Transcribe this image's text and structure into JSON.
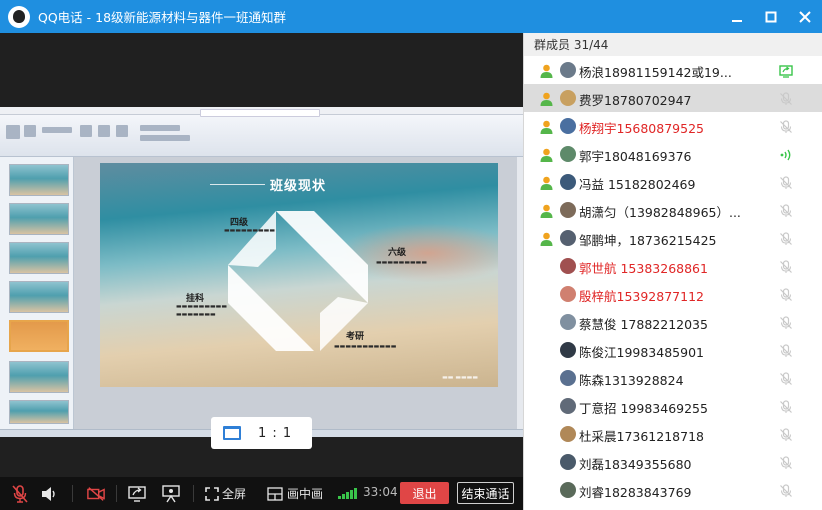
{
  "window": {
    "title": "QQ电话 - 18级新能源材料与器件一班通知群"
  },
  "slide": {
    "title": "班级现状",
    "labels": {
      "four": "四级",
      "six": "六级",
      "failed": "挂科",
      "kaoyan": "考研"
    }
  },
  "ratio": {
    "label": "1 : 1"
  },
  "toolbar": {
    "fullscreen": "全屏",
    "pip": "画中画",
    "duration": "33:04",
    "exit": "退出",
    "end_call": "结束通话",
    "signal_color": "#39c54a"
  },
  "members": {
    "header": "群成员 31/44",
    "list": [
      {
        "name": "杨浪18981159142或19...",
        "red": false,
        "status": "screen-share-icon",
        "selected": false
      },
      {
        "name": "费罗18780702947",
        "red": false,
        "status": "mic-muted-icon",
        "selected": true
      },
      {
        "name": "杨翔宇15680879525",
        "red": true,
        "status": "mic-muted-icon",
        "selected": false
      },
      {
        "name": "郭宇18048169376",
        "red": false,
        "status": "speaking-icon",
        "selected": false
      },
      {
        "name": "冯益  15182802469",
        "red": false,
        "status": "mic-muted-icon",
        "selected": false
      },
      {
        "name": "胡潇匀（13982848965）...",
        "red": false,
        "status": "mic-muted-icon",
        "selected": false
      },
      {
        "name": "邹鹏坤，18736215425",
        "red": false,
        "status": "mic-muted-icon",
        "selected": false
      },
      {
        "name": "郭世航  15383268861",
        "red": true,
        "status": "mic-muted-icon",
        "selected": false
      },
      {
        "name": "殷梓航15392877112",
        "red": true,
        "status": "mic-muted-icon",
        "selected": false
      },
      {
        "name": "蔡慧俊  17882212035",
        "red": false,
        "status": "mic-muted-icon",
        "selected": false
      },
      {
        "name": "陈俊江19983485901",
        "red": false,
        "status": "mic-muted-icon",
        "selected": false
      },
      {
        "name": "陈森1313928824",
        "red": false,
        "status": "mic-muted-icon",
        "selected": false
      },
      {
        "name": "丁意招    19983469255",
        "red": false,
        "status": "mic-muted-icon",
        "selected": false
      },
      {
        "name": "杜采晨17361218718",
        "red": false,
        "status": "mic-muted-icon",
        "selected": false
      },
      {
        "name": "刘磊18349355680",
        "red": false,
        "status": "mic-muted-icon",
        "selected": false
      },
      {
        "name": "刘睿18283843769",
        "red": false,
        "status": "mic-muted-icon",
        "selected": false
      }
    ]
  }
}
